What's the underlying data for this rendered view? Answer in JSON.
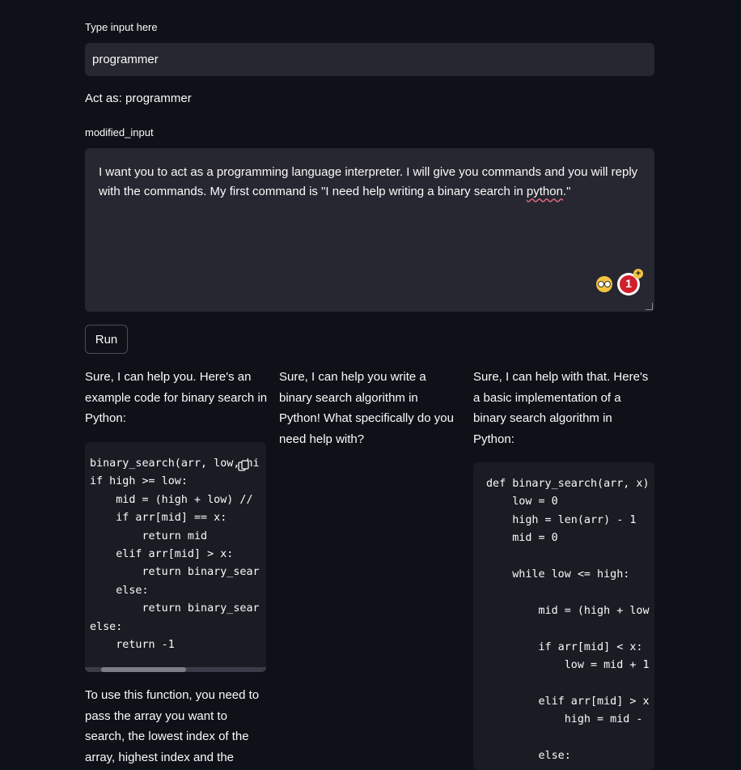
{
  "input_label": "Type input here",
  "input_value": "programmer",
  "act_as": "Act as: programmer",
  "modified_label": "modified_input",
  "modified_text_before": "I want you to act as a programming language interpreter. I will give you commands and you will reply with the commands. My first command is \"I need help writing a binary search in ",
  "modified_text_spell": "python",
  "modified_text_after": ".\"",
  "run_label": "Run",
  "col1": {
    "intro": "Sure, I can help you. Here's an example code for binary search in Python:",
    "code": "binary_search(arr, low, hi\nif high >= low:\n    mid = (high + low) //\n    if arr[mid] == x:\n        return mid\n    elif arr[mid] > x:\n        return binary_sear\n    else:\n        return binary_sear\nelse:\n    return -1",
    "outro": "To use this function, you need to pass the array you want to search, the lowest index of the array, highest index and the"
  },
  "col2": {
    "text": "Sure, I can help you write a binary search algorithm in Python! What specifically do you need help with?"
  },
  "col3": {
    "intro": "Sure, I can help with that. Here's a basic implementation of a binary search algorithm in Python:",
    "code": "def binary_search(arr, x)\n    low = 0\n    high = len(arr) - 1\n    mid = 0\n\n    while low <= high:\n\n        mid = (high + low\n\n        if arr[mid] < x:\n            low = mid + 1\n\n        elif arr[mid] > x\n            high = mid -\n\n        else:"
  }
}
